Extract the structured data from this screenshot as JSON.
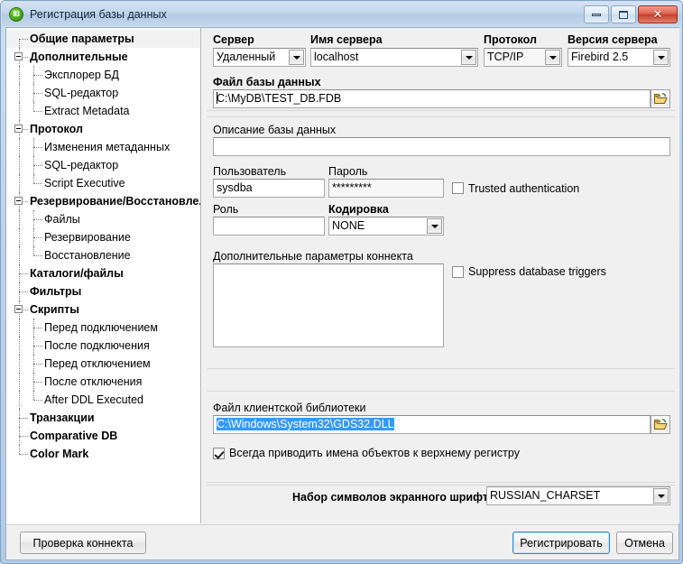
{
  "window": {
    "title": "Регистрация базы данных",
    "app_icon": "IB",
    "minimize_label": "Свернуть",
    "maximize_label": "Развернуть",
    "close_label": "Закрыть"
  },
  "tree": {
    "items": [
      {
        "label": "Общие параметры",
        "level": 0,
        "expander": false,
        "selected": true
      },
      {
        "label": "Дополнительные",
        "level": 0,
        "expander": true,
        "selected": false
      },
      {
        "label": "Эксплорер БД",
        "level": 1,
        "expander": false,
        "selected": false
      },
      {
        "label": "SQL-редактор",
        "level": 1,
        "expander": false,
        "selected": false
      },
      {
        "label": "Extract Metadata",
        "level": 1,
        "expander": false,
        "selected": false
      },
      {
        "label": "Протокол",
        "level": 0,
        "expander": true,
        "selected": false
      },
      {
        "label": "Изменения метаданных",
        "level": 1,
        "expander": false,
        "selected": false
      },
      {
        "label": "SQL-редактор",
        "level": 1,
        "expander": false,
        "selected": false
      },
      {
        "label": "Script Executive",
        "level": 1,
        "expander": false,
        "selected": false
      },
      {
        "label": "Резервирование/Восстановле...",
        "level": 0,
        "expander": true,
        "selected": false
      },
      {
        "label": "Файлы",
        "level": 1,
        "expander": false,
        "selected": false
      },
      {
        "label": "Резервирование",
        "level": 1,
        "expander": false,
        "selected": false
      },
      {
        "label": "Восстановление",
        "level": 1,
        "expander": false,
        "selected": false
      },
      {
        "label": "Каталоги/файлы",
        "level": 0,
        "expander": false,
        "selected": false
      },
      {
        "label": "Фильтры",
        "level": 0,
        "expander": false,
        "selected": false
      },
      {
        "label": "Скрипты",
        "level": 0,
        "expander": true,
        "selected": false
      },
      {
        "label": "Перед подключением",
        "level": 1,
        "expander": false,
        "selected": false
      },
      {
        "label": "После подключения",
        "level": 1,
        "expander": false,
        "selected": false
      },
      {
        "label": "Перед отключением",
        "level": 1,
        "expander": false,
        "selected": false
      },
      {
        "label": "После отключения",
        "level": 1,
        "expander": false,
        "selected": false
      },
      {
        "label": "After DDL Executed",
        "level": 1,
        "expander": false,
        "selected": false
      },
      {
        "label": "Транзакции",
        "level": 0,
        "expander": false,
        "selected": false
      },
      {
        "label": "Comparative DB",
        "level": 0,
        "expander": false,
        "selected": false
      },
      {
        "label": "Color Mark",
        "level": 0,
        "expander": false,
        "selected": false
      }
    ]
  },
  "form": {
    "server": {
      "label": "Сервер",
      "value": "Удаленный"
    },
    "server_name": {
      "label": "Имя сервера",
      "value": "localhost"
    },
    "protocol": {
      "label": "Протокол",
      "value": "TCP/IP"
    },
    "server_version": {
      "label": "Версия сервера",
      "value": "Firebird 2.5"
    },
    "db_file": {
      "label": "Файл базы данных",
      "value": "C:\\MyDB\\TEST_DB.FDB"
    },
    "db_description": {
      "label": "Описание базы данных",
      "value": ""
    },
    "user": {
      "label": "Пользователь",
      "value": "sysdba"
    },
    "password": {
      "label": "Пароль",
      "value": "*********"
    },
    "trusted_auth": {
      "label": "Trusted authentication",
      "checked": false
    },
    "role": {
      "label": "Роль",
      "value": ""
    },
    "charset": {
      "label": "Кодировка",
      "value": "NONE"
    },
    "extra_params": {
      "label": "Дополнительные параметры коннекта",
      "value": ""
    },
    "suppress_triggers": {
      "label": "Suppress database triggers",
      "checked": false
    },
    "client_library": {
      "label": "Файл клиентской библиотеки",
      "value": "C:\\Windows\\System32\\GDS32.DLL",
      "selected": true
    },
    "uppercase_names": {
      "label": "Всегда приводить имена объектов к верхнему регистру",
      "checked": true
    },
    "screen_charset": {
      "label": "Набор символов экранного шрифта",
      "value": "RUSSIAN_CHARSET"
    }
  },
  "buttons": {
    "test_connection": "Проверка коннекта",
    "register": "Регистрировать",
    "cancel": "Отмена"
  },
  "colors": {
    "selection_blue": "#3399ff",
    "title_blue": "#c0d4ea",
    "default_button_border": "#2e8bd0"
  }
}
